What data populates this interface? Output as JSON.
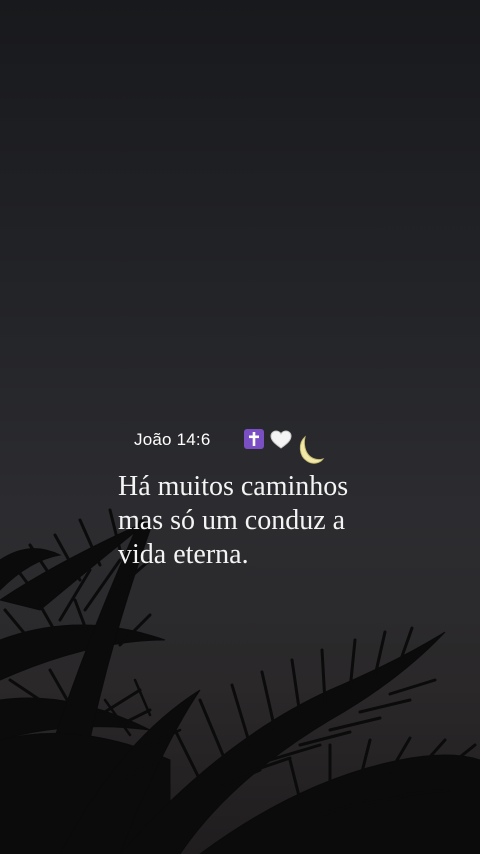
{
  "story": {
    "reference": "João 14:6",
    "emojis": [
      "latin-cross-emoji",
      "white-heart-emoji",
      "crescent-moon-emoji"
    ],
    "quote_lines": [
      "Há muitos caminhos",
      "mas só um conduz a",
      "vida eterna."
    ]
  },
  "colors": {
    "sky_top": "#18191c",
    "sky_mid": "#2c2c30",
    "palm_silhouette": "#0b0b0c",
    "text": "#f4f4f4",
    "cross_emoji_bg": "#7a4fc4"
  }
}
